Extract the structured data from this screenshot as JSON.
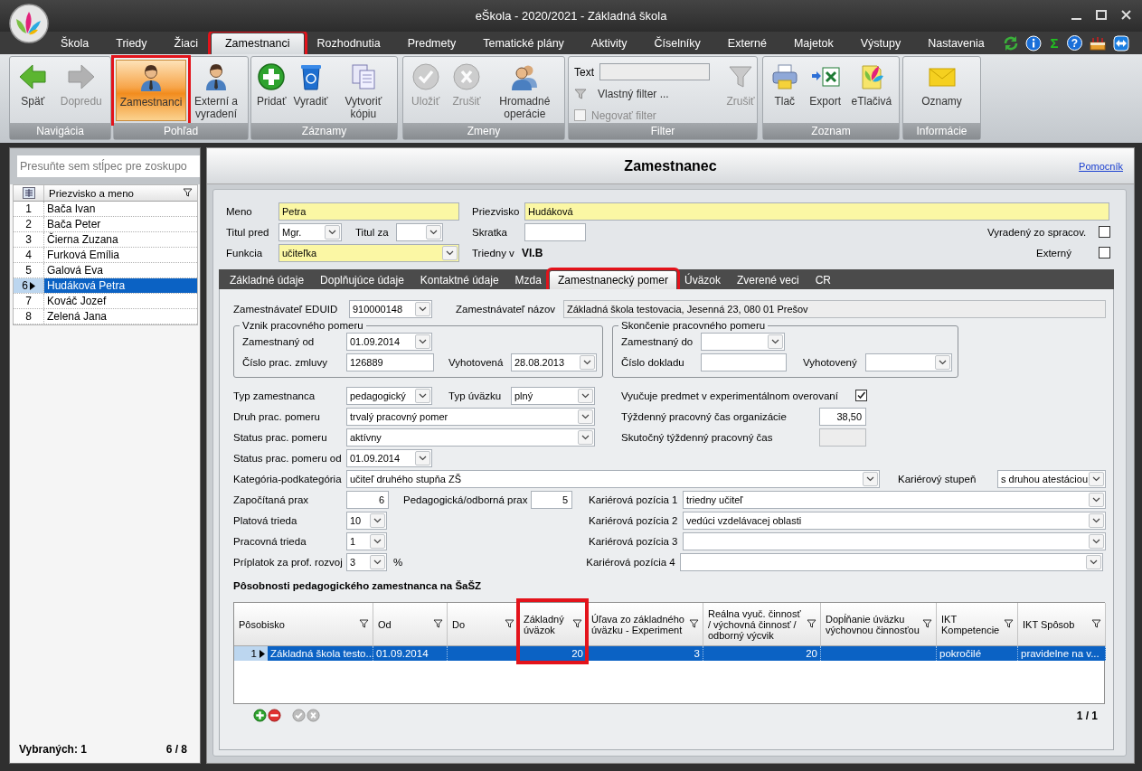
{
  "window": {
    "title": "eŠkola - 2020/2021 - Základná škola"
  },
  "menu": [
    {
      "label": "Škola",
      "selected": false,
      "highlighted": false
    },
    {
      "label": "Triedy",
      "selected": false,
      "highlighted": false
    },
    {
      "label": "Žiaci",
      "selected": false,
      "highlighted": false
    },
    {
      "label": "Zamestnanci",
      "selected": true,
      "highlighted": true
    },
    {
      "label": "Rozhodnutia",
      "selected": false,
      "highlighted": false
    },
    {
      "label": "Predmety",
      "selected": false,
      "highlighted": false
    },
    {
      "label": "Tematické plány",
      "selected": false,
      "highlighted": false
    },
    {
      "label": "Aktivity",
      "selected": false,
      "highlighted": false
    },
    {
      "label": "Číselníky",
      "selected": false,
      "highlighted": false
    },
    {
      "label": "Externé",
      "selected": false,
      "highlighted": false
    },
    {
      "label": "Majetok",
      "selected": false,
      "highlighted": false
    },
    {
      "label": "Výstupy",
      "selected": false,
      "highlighted": false
    },
    {
      "label": "Nastavenia",
      "selected": false,
      "highlighted": false
    }
  ],
  "quick_tools": [
    {
      "kind": "refresh"
    },
    {
      "kind": "info"
    },
    {
      "kind": "sum",
      "label": "Σ"
    },
    {
      "kind": "help",
      "label": "?"
    },
    {
      "kind": "cake"
    },
    {
      "kind": "remote"
    }
  ],
  "ribbon": [
    {
      "label": "Navigácia",
      "buttons": [
        {
          "kind": "back",
          "label": "Späť",
          "disabled": false
        },
        {
          "kind": "forward",
          "label": "Dopredu",
          "disabled": true
        }
      ]
    },
    {
      "label": "Pohľad",
      "buttons": [
        {
          "kind": "person",
          "label": "Zamestnanci",
          "disabled": false,
          "selected": true,
          "highlighted": true
        },
        {
          "kind": "person",
          "label": "Externí a vyradení",
          "disabled": false,
          "selected": false,
          "highlighted": false
        }
      ]
    },
    {
      "label": "Záznamy",
      "buttons": [
        {
          "kind": "add",
          "label": "Pridať",
          "disabled": false
        },
        {
          "kind": "recycle",
          "label": "Vyradiť",
          "disabled": false
        },
        {
          "kind": "copy",
          "label": "Vytvoriť kópiu",
          "disabled": false
        }
      ]
    },
    {
      "label": "Zmeny",
      "buttons": [
        {
          "kind": "save",
          "label": "Uložiť",
          "disabled": true
        },
        {
          "kind": "cancel",
          "label": "Zrušiť",
          "disabled": true
        },
        {
          "kind": "group",
          "label": "Hromadné operácie",
          "disabled": false
        }
      ]
    },
    {
      "label": "Filter",
      "kind": "filter",
      "text_label": "Text",
      "custom_filter": "Vlastný filter ...",
      "negate": {
        "label": "Negovať filter",
        "checked": false,
        "disabled": true
      },
      "buttons": [
        {
          "kind": "funnel",
          "label": "Zrušiť",
          "disabled": true
        }
      ]
    },
    {
      "label": "Zoznam",
      "buttons": [
        {
          "kind": "print",
          "label": "Tlač",
          "disabled": false
        },
        {
          "kind": "export",
          "label": "Export",
          "disabled": false
        },
        {
          "kind": "forms",
          "label": "eTlačivá",
          "disabled": false
        }
      ]
    },
    {
      "label": "Informácie",
      "buttons": [
        {
          "kind": "mail",
          "label": "Oznamy",
          "disabled": false
        }
      ]
    }
  ],
  "employees": {
    "group_hint": "Presuňte sem stĺpec pre zoskupo",
    "column": "Priezvisko a meno",
    "rows": [
      {
        "number": "1",
        "name": "Bača Ivan",
        "selected": false
      },
      {
        "number": "2",
        "name": "Bača Peter",
        "selected": false
      },
      {
        "number": "3",
        "name": "Čierna Zuzana",
        "selected": false
      },
      {
        "number": "4",
        "name": "Furková Emília",
        "selected": false
      },
      {
        "number": "5",
        "name": "Galová Eva",
        "selected": false
      },
      {
        "number": "6",
        "name": "Hudáková Petra",
        "selected": true
      },
      {
        "number": "7",
        "name": "Kováč Jozef",
        "selected": false
      },
      {
        "number": "8",
        "name": "Zelená Jana",
        "selected": false
      }
    ],
    "selected_label": "Vybraných: 1",
    "count": "6 / 8"
  },
  "detail": {
    "title": "Zamestnanec",
    "help_link": "Pomocník",
    "header_rows": [
      [
        {
          "kind": "input",
          "label": "Meno",
          "value": "Petra",
          "required": true
        },
        {
          "kind": "input",
          "label": "Priezvisko",
          "value": "Hudáková",
          "required": true
        }
      ],
      [
        {
          "kind": "combo",
          "label": "Titul pred",
          "value": "Mgr.",
          "required": false
        },
        {
          "kind": "combo",
          "label": "Titul za",
          "required": false
        },
        {
          "kind": "input",
          "label": "Skratka",
          "required": false
        },
        {
          "kind": "check",
          "label": "Vyradený zo spracov.",
          "checked": false
        }
      ],
      [
        {
          "kind": "combo",
          "label": "Funkcia",
          "value": "učiteľka",
          "required": true
        },
        {
          "kind": "info",
          "label": "Triedny v",
          "value": "VI.B"
        },
        {
          "kind": "check",
          "label": "Externý",
          "checked": false
        }
      ]
    ],
    "tabs": [
      {
        "label": "Základné údaje",
        "selected": false,
        "highlighted": false
      },
      {
        "label": "Doplňujúce údaje",
        "selected": false,
        "highlighted": false
      },
      {
        "label": "Kontaktné údaje",
        "selected": false,
        "highlighted": false
      },
      {
        "label": "Mzda",
        "selected": false,
        "highlighted": false
      },
      {
        "label": "Zamestnanecký pomer",
        "selected": true,
        "highlighted": true
      },
      {
        "label": "Úväzok",
        "selected": false,
        "highlighted": false
      },
      {
        "label": "Zverené veci",
        "selected": false,
        "highlighted": false
      },
      {
        "label": "CR",
        "selected": false,
        "highlighted": false
      }
    ],
    "employer_row": [
      {
        "kind": "combo",
        "label": "Zamestnávateľ EDUID",
        "value": "910000148"
      },
      {
        "kind": "readonly",
        "label": "Zamestnávateľ názov",
        "value": "Základná škola testovacia, Jesenná 23, 080 01 Prešov"
      }
    ],
    "groups": [
      {
        "title": "Vznik pracovného pomeru",
        "rows": [
          [
            {
              "kind": "combo",
              "label": "Zamestnaný od",
              "value": "01.09.2014"
            }
          ],
          [
            {
              "kind": "input",
              "label": "Číslo prac. zmluvy",
              "value": "126889"
            },
            {
              "kind": "combo",
              "label": "Vyhotovená",
              "value": "28.08.2013"
            }
          ]
        ]
      },
      {
        "title": "Skončenie pracovného pomeru",
        "rows": [
          [
            {
              "kind": "combo",
              "label": "Zamestnaný do"
            }
          ],
          [
            {
              "kind": "input",
              "label": "Číslo dokladu"
            },
            {
              "kind": "combo",
              "label": "Vyhotovený"
            }
          ]
        ]
      }
    ],
    "rows": [
      [
        {
          "kind": "combo",
          "label": "Typ zamestnanca",
          "value": "pedagogický"
        },
        {
          "kind": "combo",
          "label": "Typ úväzku",
          "value": "plný"
        },
        {
          "kind": "check",
          "label": "Vyučuje predmet v experimentálnom overovaní",
          "checked": true
        }
      ],
      [
        {
          "kind": "combo",
          "label": "Druh prac. pomeru",
          "value": "trvalý pracovný pomer"
        },
        {
          "kind": "number",
          "label": "Týždenný pracovný čas organizácie",
          "value": "38,50"
        }
      ],
      [
        {
          "kind": "combo",
          "label": "Status prac. pomeru",
          "value": "aktívny"
        },
        {
          "kind": "readonly",
          "label": "Skutočný týždenný pracovný čas"
        }
      ],
      [
        {
          "kind": "combo",
          "label": "Status prac. pomeru od",
          "value": "01.09.2014"
        }
      ],
      [
        {
          "kind": "combo",
          "label": "Kategória-podkategória",
          "value": "učiteľ druhého stupňa ZŠ"
        },
        {
          "kind": "combo",
          "label": "Kariérový stupeň",
          "value": "s druhou atestáciou"
        }
      ],
      [
        {
          "kind": "number",
          "label": "Započítaná prax",
          "value": "6"
        },
        {
          "kind": "number",
          "label": "Pedagogická/odborná prax",
          "value": "5"
        },
        {
          "kind": "combo",
          "label": "Kariérová pozícia 1",
          "value": "triedny učiteľ"
        }
      ],
      [
        {
          "kind": "combo",
          "label": "Platová trieda",
          "value": "10"
        },
        {
          "kind": "combo",
          "label": "Kariérová pozícia 2",
          "value": "vedúci vzdelávacej oblasti"
        }
      ],
      [
        {
          "kind": "combo",
          "label": "Pracovná trieda",
          "value": "1"
        },
        {
          "kind": "combo",
          "label": "Kariérová pozícia 3"
        }
      ],
      [
        {
          "kind": "combo",
          "label": "Príplatok za prof. rozvoj",
          "value": "3",
          "suffix": "%"
        },
        {
          "kind": "combo",
          "label": "Kariérová pozícia 4"
        }
      ]
    ],
    "assignments": {
      "title": "Pôsobnosti pedagogického zamestnanca na ŠaŠZ",
      "columns": [
        {
          "label": "Pôsobisko",
          "highlighted": false
        },
        {
          "label": "Od",
          "highlighted": false
        },
        {
          "label": "Do",
          "highlighted": false
        },
        {
          "label": "Základný úväzok",
          "highlighted": true
        },
        {
          "label": "Úľava zo základného úväzku - Experiment",
          "highlighted": false
        },
        {
          "label": "Reálna vyuč. činnosť / výchovná činnosť / odborný výcvik",
          "highlighted": false
        },
        {
          "label": "Dopĺňanie úväzku výchovnou činnosťou",
          "highlighted": false
        },
        {
          "label": "IKT Kompetencie",
          "highlighted": false
        },
        {
          "label": "IKT Spôsob",
          "highlighted": false
        }
      ],
      "rows": [
        {
          "number": "1",
          "selected": true,
          "cells": [
            "Základná škola testo...",
            "01.09.2014",
            null,
            "20",
            "3",
            "20",
            null,
            "pokročilé",
            "pravidelne na v..."
          ]
        }
      ],
      "pager": "1 / 1"
    }
  }
}
